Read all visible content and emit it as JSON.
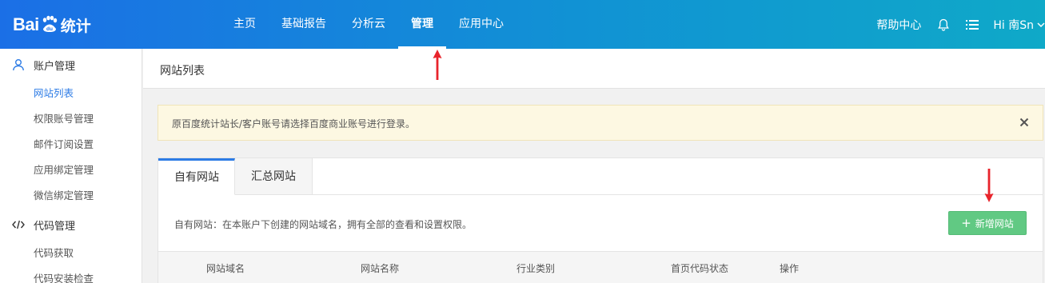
{
  "header": {
    "logo_text": "Bai",
    "logo_du": "du",
    "logo_suffix": "统计",
    "nav": [
      {
        "label": "主页"
      },
      {
        "label": "基础报告"
      },
      {
        "label": "分析云"
      },
      {
        "label": "管理",
        "active": true
      },
      {
        "label": "应用中心"
      }
    ],
    "help_label": "帮助中心",
    "bell_icon": "bell-icon",
    "menu_icon": "list-icon",
    "user_greeting": "Hi  南Sn"
  },
  "sidebar": {
    "groups": [
      {
        "label": "账户管理",
        "icon": "user-icon",
        "items": [
          {
            "label": "网站列表",
            "active": true
          },
          {
            "label": "权限账号管理"
          },
          {
            "label": "邮件订阅设置"
          },
          {
            "label": "应用绑定管理"
          },
          {
            "label": "微信绑定管理"
          }
        ]
      },
      {
        "label": "代码管理",
        "icon": "code-icon",
        "items": [
          {
            "label": "代码获取"
          },
          {
            "label": "代码安装检查"
          }
        ]
      }
    ]
  },
  "main": {
    "page_title": "网站列表",
    "notice": "原百度统计站长/客户账号请选择百度商业账号进行登录。",
    "tabs": [
      {
        "label": "自有网站",
        "active": true
      },
      {
        "label": "汇总网站"
      }
    ],
    "description": "自有网站：在本账户下创建的网站域名，拥有全部的查看和设置权限。",
    "add_button": "新增网站",
    "table_headers": [
      "网站域名",
      "网站名称",
      "行业类别",
      "首页代码状态",
      "操作"
    ]
  },
  "colors": {
    "header_gradient_start": "#1b6fe6",
    "header_gradient_end": "#0fa9c8",
    "accent": "#2c7be5",
    "add_button": "#61c983",
    "notice_bg": "#fdf8e2",
    "annotation_arrow": "#e8242b"
  }
}
